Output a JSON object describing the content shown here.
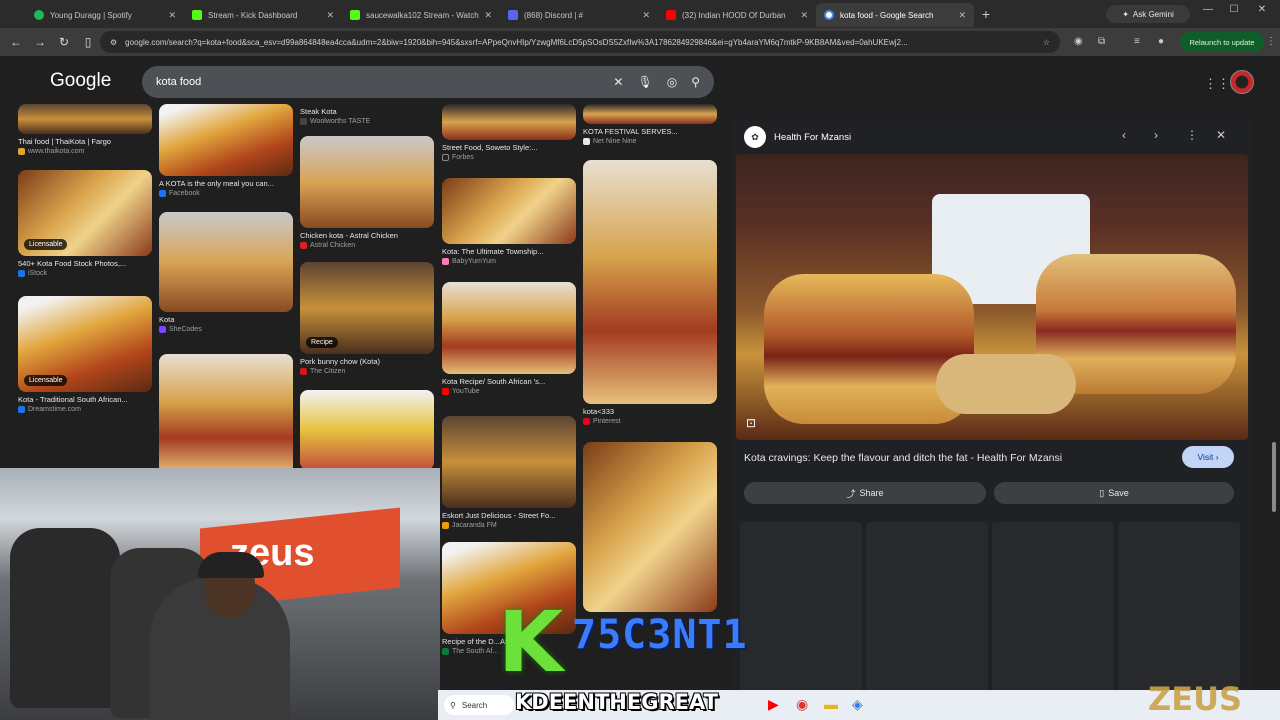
{
  "tabs": [
    {
      "label": "Young Duragg | Spotify",
      "color": "#1db954",
      "active": false
    },
    {
      "label": "Stream - Kick Dashboard",
      "color": "#53fc18",
      "active": false
    },
    {
      "label": "saucewalka102 Stream - Watch",
      "color": "#53fc18",
      "active": false
    },
    {
      "label": "(868) Discord | #",
      "color": "#5865f2",
      "active": false
    },
    {
      "label": "(32) Indian HOOD Of Durban",
      "color": "#ff0000",
      "active": false
    },
    {
      "label": "kota food - Google Search",
      "color": "#4285f4",
      "active": true
    }
  ],
  "browser": {
    "ask_gemini": "Ask Gemini",
    "url": "google.com/search?q=kota+food&sca_esv=d99a864848ea4cca&udm=2&biw=1920&bih=945&sxsrf=APpeQnvHIp/YzwgMf6LcD5pSOsDS5ZxfIw%3A1786284929846&ei=gYb4araYM6q7mtkP-9KB8AM&ved=0ahUKEwj2...",
    "relaunch": "Relaunch to update"
  },
  "google": {
    "logo": "Google",
    "query": "kota food"
  },
  "results": [
    {
      "caption": "Thai food | ThaiKota | Fargo",
      "source": "www.thaikota.com",
      "color": "#e0a52c"
    },
    {
      "caption": "540+ Kota Food Stock Photos,...",
      "source": "iStock",
      "badge": "Licensable",
      "color": "#1a73e8"
    },
    {
      "caption": "Kota - Traditional South African...",
      "source": "Dreamstime.com",
      "badge": "Licensable",
      "color": "#1a73e8"
    },
    {
      "caption": "A KOTA is the only meal you can...",
      "source": "Facebook",
      "color": "#1877f2"
    },
    {
      "caption": "Kota",
      "source": "SheCodes",
      "color": "#7b46ff"
    },
    {
      "caption": "Steak Kota",
      "source": "Woolworths TASTE",
      "color": "#444"
    },
    {
      "caption": "Chicken kota - Astral Chicken",
      "source": "Astral Chicken",
      "color": "#e02020"
    },
    {
      "caption": "Pork bunny chow (Kota)",
      "source": "The Citizen",
      "badge": "Recipe",
      "color": "#d01818"
    },
    {
      "caption": "Street Food, Soweto Style:...",
      "source": "Forbes",
      "color": "#222"
    },
    {
      "caption": "Kota: The Ultimate Township...",
      "source": "BabyYumYum",
      "color": "#ff7ab8"
    },
    {
      "caption": "Kota Recipe/ South African 's...",
      "source": "YouTube",
      "color": "#ff0000"
    },
    {
      "caption": "Eskort Just Delicious - Street Fo...",
      "source": "Jacaranda FM",
      "color": "#f59c00"
    },
    {
      "caption": "Recipe of the D...African...",
      "source": "The South Af...",
      "color": "#0a7c3a"
    },
    {
      "caption": "KOTA FESTIVAL SERVES...",
      "source": "Net Nine Nine",
      "color": "#e8e8e8"
    },
    {
      "caption": "kota<333",
      "source": "Pinterest",
      "color": "#e60023"
    }
  ],
  "panel": {
    "source": "Health For Mzansi",
    "title": "Kota cravings: Keep the flavour and ditch the fat - Health For Mzansi",
    "visit": "Visit",
    "share": "Share",
    "save": "Save"
  },
  "overlay": {
    "k_mark": "K",
    "streamer_name": "75C3NT1",
    "banner_name": "KDEENTHEGREAT",
    "zeus_small": "zeus",
    "zeus_corner": "ZEUS"
  },
  "taskbar": {
    "search": "Search"
  }
}
